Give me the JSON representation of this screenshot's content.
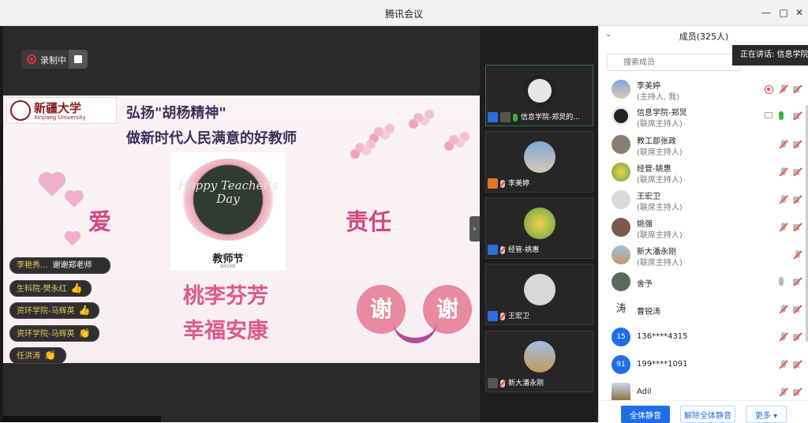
{
  "window": {
    "title": "腾讯会议",
    "min": "—",
    "max": "□",
    "close": "✕"
  },
  "recording": {
    "label": "录制中"
  },
  "slide": {
    "logo_cn": "新疆大学",
    "logo_en": "Xinjiang University",
    "title_line1": "弘扬\"胡杨精神\"",
    "title_line2": "做新时代人民满意的好教师",
    "card_happy": "Happy Teacher's Day",
    "card_caption": "教师节",
    "card_date": "9月10日",
    "word_left": "爱",
    "word_right": "责任",
    "line1": "桃李芬芳",
    "line2": "幸福安康",
    "bubble1": "谢",
    "bubble2": "谢"
  },
  "chat": [
    {
      "sender": "李艳秀...",
      "message": "谢谢郑老师",
      "emoji": ""
    },
    {
      "sender": "生科院-樊永红",
      "message": "",
      "emoji": "👍"
    },
    {
      "sender": "资环学院-马辉英",
      "message": "",
      "emoji": "👍"
    },
    {
      "sender": "资环学院-马辉英",
      "message": "",
      "emoji": "👏"
    },
    {
      "sender": "任洪涛",
      "message": "",
      "emoji": "👏"
    }
  ],
  "thumbs": [
    {
      "name": "信息学院-郑炅的..."
    },
    {
      "name": "李美婷"
    },
    {
      "name": "经管-姚惠"
    },
    {
      "name": "王宏卫"
    },
    {
      "name": "新大潘永刚"
    }
  ],
  "panel": {
    "title": "成员(325人)",
    "speaking": "正在讲话: 信息学院-",
    "search_placeholder": "搜索成员",
    "buttons": {
      "mute_all": "全体静音",
      "unmute_all": "解除全体静音",
      "more": "更多 ▾"
    }
  },
  "members": [
    {
      "name": "李美婷",
      "role": "(主持人, 我)",
      "avatar": ""
    },
    {
      "name": "信息学院-郑炅",
      "role": "(联席主持人)",
      "avatar": ""
    },
    {
      "name": "教工部张政",
      "role": "(联席主持人)",
      "avatar": ""
    },
    {
      "name": "经管-姚惠",
      "role": "(联席主持人)",
      "avatar": ""
    },
    {
      "name": "王宏卫",
      "role": "(联席主持人)",
      "avatar": ""
    },
    {
      "name": "姚强",
      "role": "(联席主持人)",
      "avatar": ""
    },
    {
      "name": "新大潘永刚",
      "role": "(联席主持人)",
      "avatar": ""
    },
    {
      "name": "舍予",
      "role": "",
      "avatar": ""
    },
    {
      "name": "曹锐涛",
      "role": "",
      "avatar": ""
    },
    {
      "name": "136****4315",
      "role": "",
      "avatar": "15"
    },
    {
      "name": "199****1091",
      "role": "",
      "avatar": "91"
    },
    {
      "name": "Adil",
      "role": "",
      "avatar": ""
    }
  ]
}
